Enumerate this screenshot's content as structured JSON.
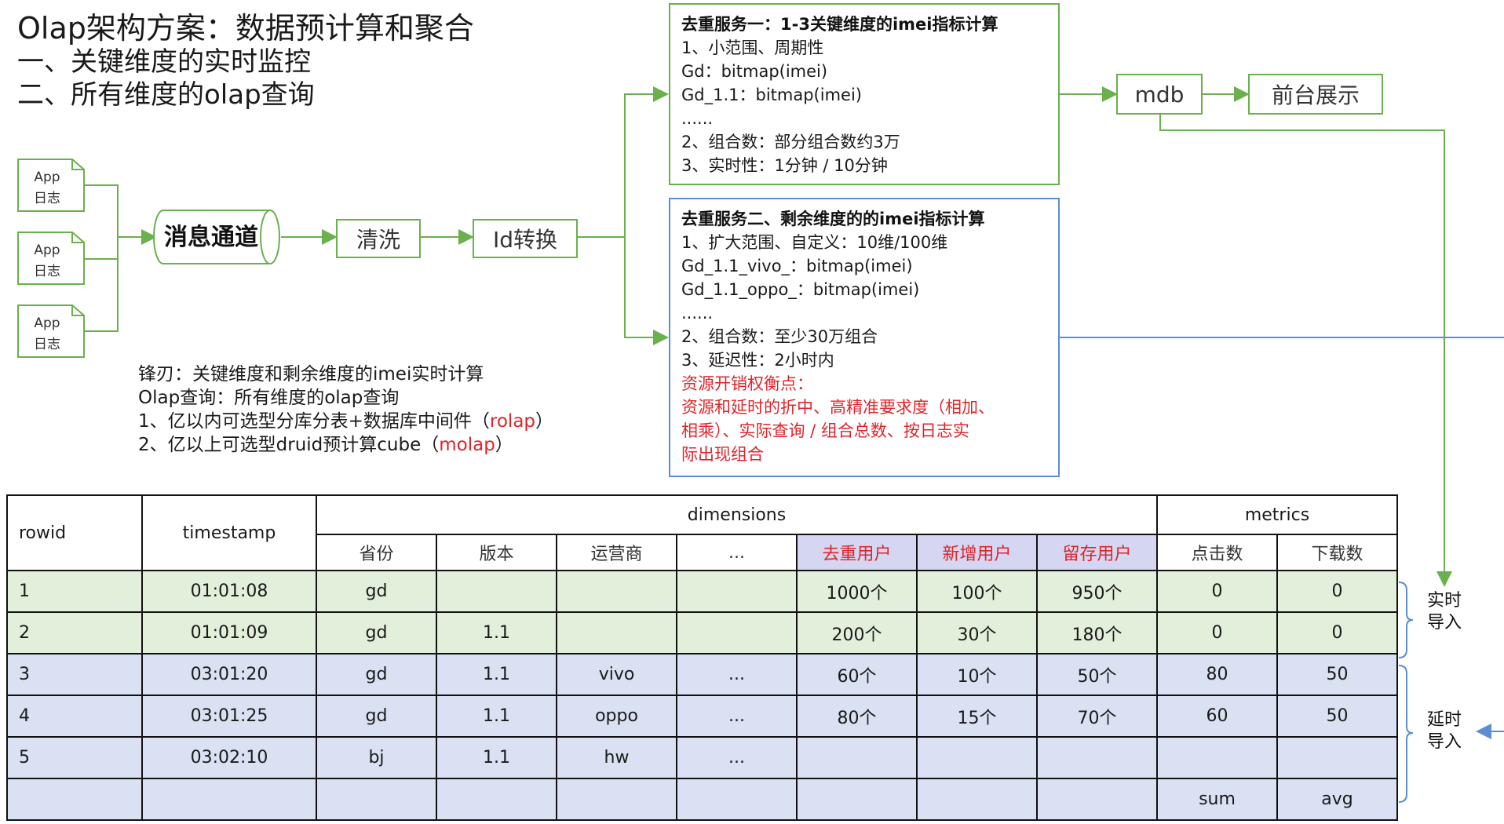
{
  "title": {
    "main": "Olap架构方案：数据预计算和聚合",
    "line1": "一、关键维度的实时监控",
    "line2": "二、所有维度的olap查询"
  },
  "sources": [
    {
      "line1": "App",
      "line2": "日志"
    },
    {
      "line1": "App",
      "line2": "日志"
    },
    {
      "line1": "App",
      "line2": "日志"
    }
  ],
  "pipeline": {
    "channel": "消息通道",
    "clean": "清洗",
    "id_convert": "Id转换",
    "mdb": "mdb",
    "frontend": "前台展示"
  },
  "service1": {
    "title": "去重服务一：1-3关键维度的imei指标计算",
    "lines": [
      "1、小范围、周期性",
      "Gd：bitmap(imei)",
      "Gd_1.1：bitmap(imei)",
      "......",
      "2、组合数：部分组合数约3万",
      "3、实时性：1分钟 / 10分钟"
    ]
  },
  "service2": {
    "title": "去重服务二、剩余维度的的imei指标计算",
    "lines": [
      "1、扩大范围、自定义：10维/100维",
      "Gd_1.1_vivo_：bitmap(imei)",
      "Gd_1.1_oppo_：bitmap(imei)",
      "......",
      "2、组合数：至少30万组合",
      "3、延迟性：2小时内"
    ],
    "red_lines": [
      "资源开销权衡点：",
      "资源和延时的折中、高精准要求度（相加、",
      "相乘）、实际查询 / 组合总数、按日志实",
      "际出现组合"
    ]
  },
  "notes": {
    "line1": "锋刃：关键维度和剩余维度的imei实时计算",
    "line2": "Olap查询：所有维度的olap查询",
    "line3_prefix": "1、亿以内可选型分库分表+数据库中间件（",
    "line3_red": "rolap",
    "line3_suffix": "）",
    "line4_prefix": "2、亿以上可选型druid预计算cube（",
    "line4_red": "molap",
    "line4_suffix": "）"
  },
  "table": {
    "col_rowid": "rowid",
    "col_timestamp": "timestamp",
    "group_dimensions": "dimensions",
    "group_metrics": "metrics",
    "sub_headers": [
      "省份",
      "版本",
      "运营商",
      "...",
      "去重用户",
      "新增用户",
      "留存用户",
      "点击数",
      "下载数"
    ],
    "rows": [
      [
        "1",
        "01:01:08",
        "gd",
        "",
        "",
        "",
        "1000个",
        "100个",
        "950个",
        "0",
        "0"
      ],
      [
        "2",
        "01:01:09",
        "gd",
        "1.1",
        "",
        "",
        "200个",
        "30个",
        "180个",
        "0",
        "0"
      ],
      [
        "3",
        "03:01:20",
        "gd",
        "1.1",
        "vivo",
        "...",
        "60个",
        "10个",
        "50个",
        "80",
        "50"
      ],
      [
        "4",
        "03:01:25",
        "gd",
        "1.1",
        "oppo",
        "...",
        "80个",
        "15个",
        "70个",
        "60",
        "50"
      ],
      [
        "5",
        "03:02:10",
        "bj",
        "1.1",
        "hw",
        "...",
        "",
        "",
        "",
        "",
        ""
      ],
      [
        "",
        "",
        "",
        "",
        "",
        "",
        "",
        "",
        "",
        "sum",
        "avg"
      ]
    ]
  },
  "side_labels": {
    "realtime_l1": "实时",
    "realtime_l2": "导入",
    "delayed_l1": "延时",
    "delayed_l2": "导入"
  },
  "colors": {
    "green_border": "#6ab04c",
    "blue_border": "#5b8ed1",
    "red_text": "#e0242a",
    "row_green": "#e2efda",
    "row_blue": "#d9e1f2",
    "header_highlight": "#d4d6f2"
  }
}
